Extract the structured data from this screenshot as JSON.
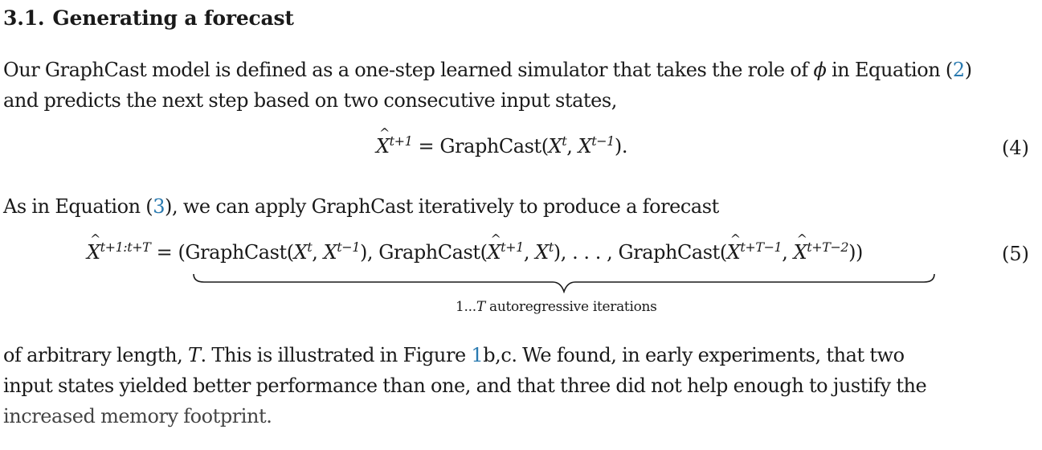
{
  "section": {
    "number": "3.1.",
    "title": "Generating a forecast"
  },
  "paragraph1": {
    "line1_a": "Our GraphCast model is defined as a one-step learned simulator that takes the role of ",
    "line1_sym": "ϕ",
    "line1_b": " in Equation (",
    "line1_ref": "2",
    "line1_c": ")",
    "line2": "and predicts the next step based on two consecutive input states,"
  },
  "equation4": {
    "lhs_var": "X",
    "lhs_sup": "t+1",
    "eq_sign": " = ",
    "func": "GraphCast(",
    "arg1_var": "X",
    "arg1_sup": "t",
    "comma": ", ",
    "arg2_var": "X",
    "arg2_sup": "t−1",
    "close": ").",
    "number": "(4)"
  },
  "paragraph2": {
    "text_a": "As in Equation (",
    "ref": "3",
    "text_b": "), we can apply GraphCast iteratively to produce a forecast"
  },
  "equation5": {
    "lhs_var": "X",
    "lhs_sup": "t+1:t+T",
    "eq_sign": " = ",
    "open": "(",
    "g1": "GraphCast(",
    "g1_a_var": "X",
    "g1_a_sup": "t",
    "g1_comma": ", ",
    "g1_b_var": "X",
    "g1_b_sup": "t−1",
    "g1_close": "), ",
    "g2": "GraphCast(",
    "g2_a_var": "X",
    "g2_a_sup": "t+1",
    "g2_comma": ", ",
    "g2_b_var": "X",
    "g2_b_sup": "t",
    "g2_close": "), . . . , ",
    "g3": "GraphCast(",
    "g3_a_var": "X",
    "g3_a_sup": "t+T−1",
    "g3_comma": ", ",
    "g3_b_var": "X",
    "g3_b_sup": "t+T−2",
    "g3_close": "))",
    "underbrace_label_a": "1...",
    "underbrace_label_var": "T",
    "underbrace_label_b": " autoregressive iterations",
    "number": "(5)"
  },
  "paragraph3": {
    "line1_a": "of arbitrary length, ",
    "line1_var": "T",
    "line1_b": ". This is illustrated in  Figure ",
    "line1_ref": "1",
    "line1_c": "b,c. We found, in early experiments, that two",
    "line2": "input states yielded better performance than one, and that three did not help enough to justify the",
    "line3": "increased memory footprint."
  },
  "colors": {
    "text": "#1a1a1a",
    "link": "#2a7ab0",
    "background": "#ffffff"
  }
}
